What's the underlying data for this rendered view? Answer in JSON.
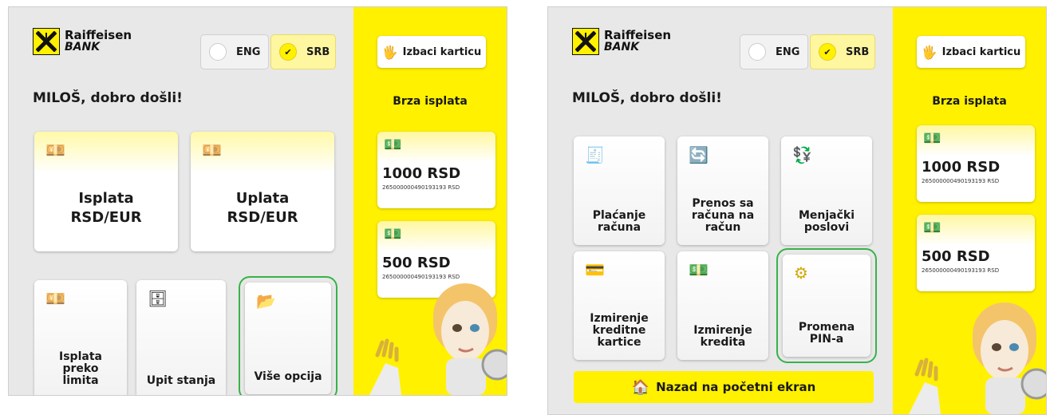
{
  "brand": {
    "line1": "Raiffeisen",
    "line2": "BANK"
  },
  "lang": {
    "eng": "ENG",
    "srb": "SRB",
    "selected": "SRB"
  },
  "welcome": "MILOŠ, dobro došli!",
  "side": {
    "eject": "Izbaci karticu",
    "quick_title": "Brza isplata",
    "quick": [
      {
        "amount": "1000 RSD",
        "account": "265000000490193193 RSD"
      },
      {
        "amount": "500 RSD",
        "account": "265000000490193193 RSD"
      }
    ]
  },
  "screen1": {
    "big_tiles": [
      {
        "label": "Isplata\nRSD/EUR",
        "icon": "cash-withdraw-icon"
      },
      {
        "label": "Uplata\nRSD/EUR",
        "icon": "cash-deposit-icon"
      }
    ],
    "small_tiles": [
      {
        "label": "Isplata\npreko\nlimita",
        "icon": "cash-withdraw-icon"
      },
      {
        "label": "Upit stanja",
        "icon": "safe-icon"
      },
      {
        "label": "Više opcija",
        "icon": "folder-icon",
        "highlighted": true
      }
    ]
  },
  "screen2": {
    "tiles": [
      {
        "label": "Plaćanje\nračuna",
        "icon": "bill-icon"
      },
      {
        "label": "Prenos sa\nračuna na\nračun",
        "icon": "transfer-icon"
      },
      {
        "label": "Menjački\nposlovi",
        "icon": "exchange-icon"
      },
      {
        "label": "Izmirenje\nkreditne\nkartice",
        "icon": "card-icon"
      },
      {
        "label": "Izmirenje\nkredita",
        "icon": "money-icon"
      },
      {
        "label": "Promena\nPIN-a",
        "icon": "gear-icon",
        "highlighted": true
      }
    ],
    "home_button": "Nazad na početni ekran"
  },
  "colors": {
    "brand_yellow": "#fff100",
    "highlight_green": "#38b24a",
    "background": "#e8e8e8"
  }
}
